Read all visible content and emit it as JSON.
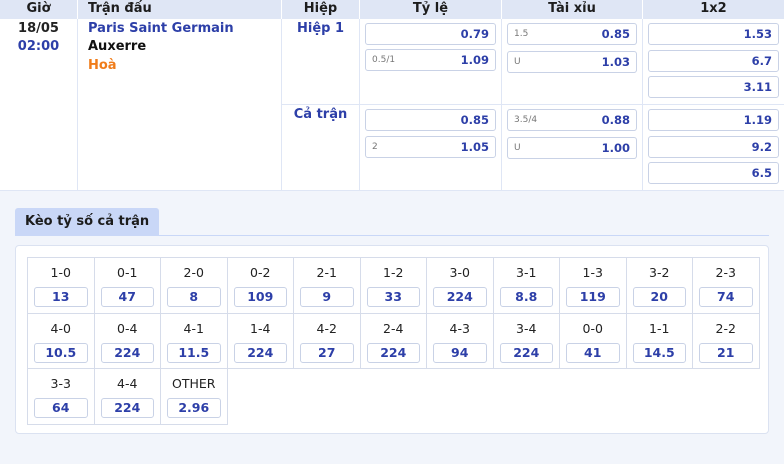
{
  "header": {
    "time": "Giờ",
    "match": "Trận đấu",
    "period": "Hiệp",
    "handicap": "Tỷ lệ",
    "overunder": "Tài xỉu",
    "onextwo": "1x2"
  },
  "match": {
    "date": "18/05",
    "time": "02:00",
    "home": "Paris Saint Germain",
    "away": "Auxerre",
    "draw": "Hoà"
  },
  "periods": [
    {
      "name": "Hiệp 1",
      "handicap": [
        {
          "label": "",
          "value": "0.79"
        },
        {
          "label": "0.5/1",
          "value": "1.09"
        }
      ],
      "overunder": [
        {
          "label": "1.5",
          "value": "0.85"
        },
        {
          "label": "U",
          "value": "1.03"
        }
      ],
      "x12": [
        "1.53",
        "6.7",
        "3.11"
      ]
    },
    {
      "name": "Cả trận",
      "handicap": [
        {
          "label": "",
          "value": "0.85"
        },
        {
          "label": "2",
          "value": "1.05"
        }
      ],
      "overunder": [
        {
          "label": "3.5/4",
          "value": "0.88"
        },
        {
          "label": "U",
          "value": "1.00"
        }
      ],
      "x12": [
        "1.19",
        "9.2",
        "6.5"
      ]
    }
  ],
  "correct_score": {
    "tab": "Kèo tỷ số cả trận",
    "items": [
      {
        "score": "1-0",
        "odds": "13"
      },
      {
        "score": "0-1",
        "odds": "47"
      },
      {
        "score": "2-0",
        "odds": "8"
      },
      {
        "score": "0-2",
        "odds": "109"
      },
      {
        "score": "2-1",
        "odds": "9"
      },
      {
        "score": "1-2",
        "odds": "33"
      },
      {
        "score": "3-0",
        "odds": "224"
      },
      {
        "score": "3-1",
        "odds": "8.8"
      },
      {
        "score": "1-3",
        "odds": "119"
      },
      {
        "score": "3-2",
        "odds": "20"
      },
      {
        "score": "2-3",
        "odds": "74"
      },
      {
        "score": "4-0",
        "odds": "10.5"
      },
      {
        "score": "0-4",
        "odds": "224"
      },
      {
        "score": "4-1",
        "odds": "11.5"
      },
      {
        "score": "1-4",
        "odds": "224"
      },
      {
        "score": "4-2",
        "odds": "27"
      },
      {
        "score": "2-4",
        "odds": "224"
      },
      {
        "score": "4-3",
        "odds": "94"
      },
      {
        "score": "3-4",
        "odds": "224"
      },
      {
        "score": "0-0",
        "odds": "41"
      },
      {
        "score": "1-1",
        "odds": "14.5"
      },
      {
        "score": "2-2",
        "odds": "21"
      },
      {
        "score": "3-3",
        "odds": "64"
      },
      {
        "score": "4-4",
        "odds": "224"
      },
      {
        "score": "OTHER",
        "odds": "2.96"
      }
    ]
  }
}
